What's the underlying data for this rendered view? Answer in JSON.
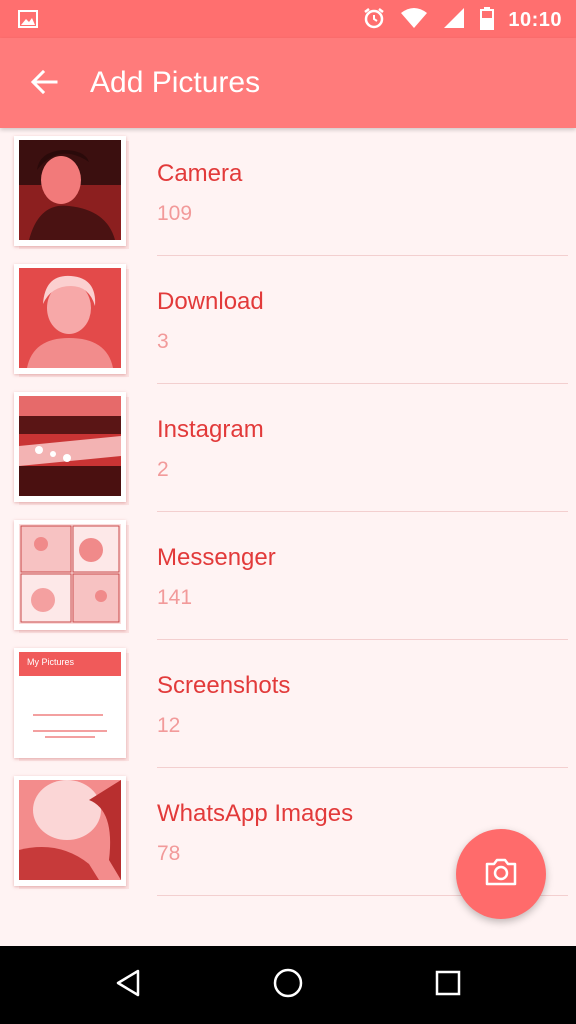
{
  "status_bar": {
    "time": "10:10",
    "icons": [
      "image-icon",
      "alarm-icon",
      "wifi-icon",
      "signal-icon",
      "battery-icon"
    ]
  },
  "app_bar": {
    "title": "Add Pictures",
    "back_icon": "arrow-back-icon"
  },
  "albums": [
    {
      "name": "Camera",
      "count": "109",
      "thumb": "portrait-photo"
    },
    {
      "name": "Download",
      "count": "3",
      "thumb": "selfie-photo"
    },
    {
      "name": "Instagram",
      "count": "2",
      "thumb": "landscape-photo"
    },
    {
      "name": "Messenger",
      "count": "141",
      "thumb": "comic-photo"
    },
    {
      "name": "Screenshots",
      "count": "12",
      "thumb": "screenshot-photo"
    },
    {
      "name": "WhatsApp Images",
      "count": "78",
      "thumb": "face-photo"
    }
  ],
  "screenshot_thumb": {
    "header": "My Pictures"
  },
  "fab": {
    "icon": "camera-icon"
  },
  "nav_bar": {
    "icons": [
      "back-triangle-icon",
      "home-circle-icon",
      "recents-square-icon"
    ]
  },
  "colors": {
    "primary": "#ff7b7b",
    "status": "#ff6f6f",
    "title_text": "#e23a3a",
    "count_text": "#f29a9a",
    "background": "#fff3f3"
  }
}
